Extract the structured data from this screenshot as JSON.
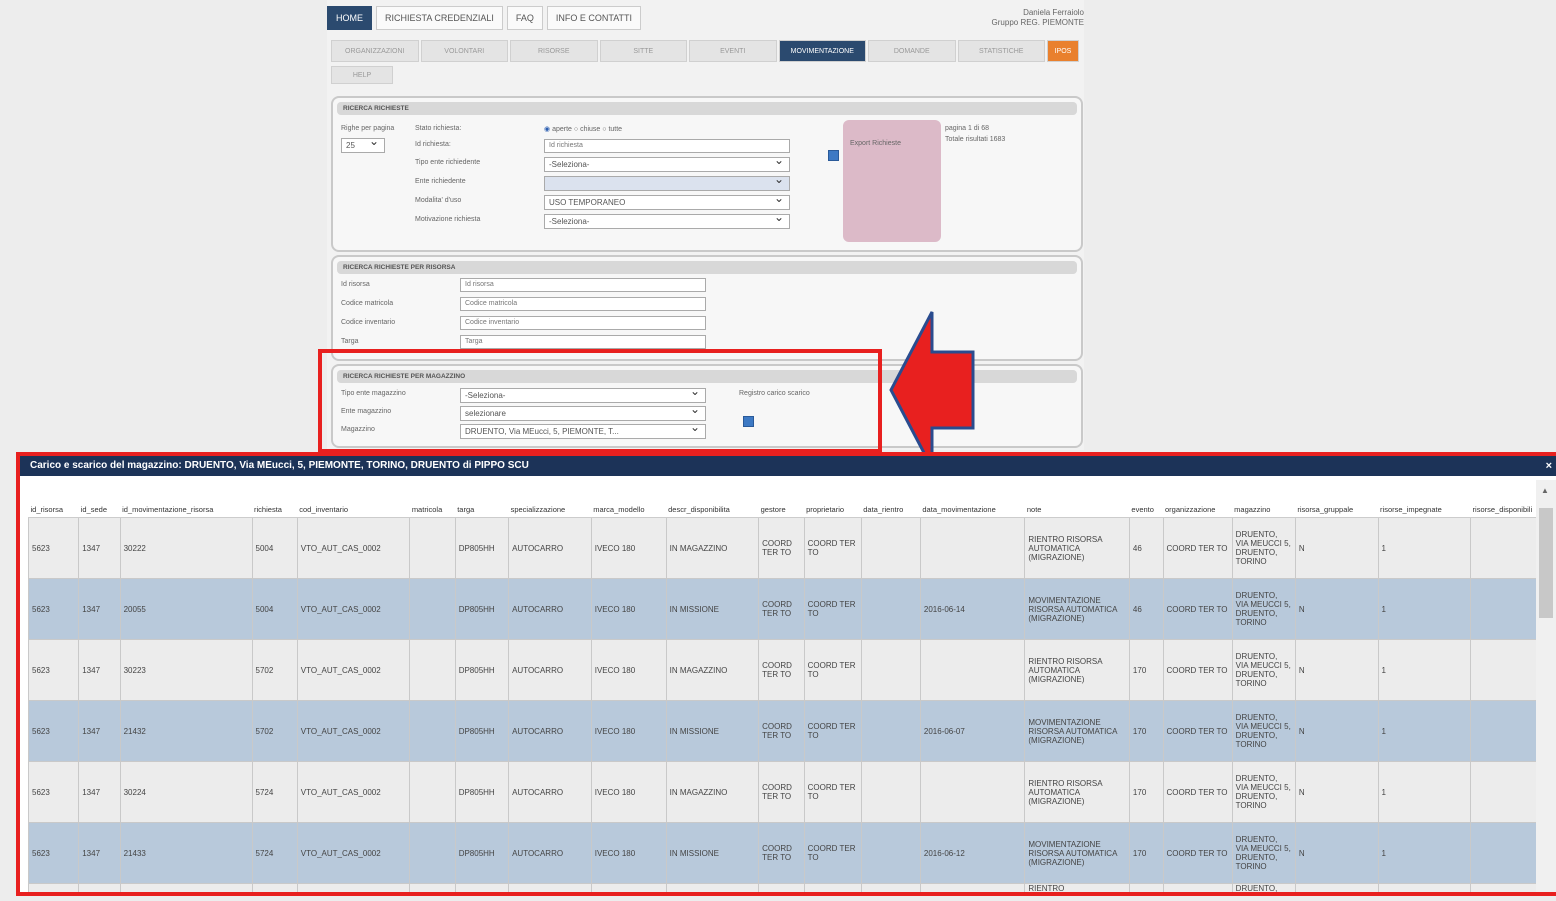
{
  "topnav": [
    "HOME",
    "RICHIESTA CREDENZIALI",
    "FAQ",
    "INFO E CONTATTI"
  ],
  "user": {
    "name": "Daniela Ferraiolo",
    "group": "Gruppo REG. PIEMONTE"
  },
  "subnav": [
    "ORGANIZZAZIONI",
    "VOLONTARI",
    "RISORSE",
    "SITTE",
    "EVENTI",
    "MOVIMENTAZIONE",
    "DOMANDE",
    "STATISTICHE",
    "IPOS"
  ],
  "help_label": "HELP",
  "ricerca": {
    "title": "RICERCA RICHIESTE",
    "righe_label": "Righe per pagina",
    "righe_value": "25",
    "stato_label": "Stato richiesta:",
    "stato_options": [
      "aperte",
      "chiuse",
      "tutte"
    ],
    "id_label": "Id richiesta:",
    "id_placeholder": "Id richiesta",
    "tipo_label": "Tipo ente richiedente",
    "tipo_value": "-Seleziona-",
    "ente_label": "Ente richiedente",
    "modalita_label": "Modalita' d'uso",
    "modalita_value": "USO TEMPORANEO",
    "motivazione_label": "Motivazione richiesta",
    "motivazione_value": "-Seleziona-",
    "export_label": "Export Richieste",
    "pagina": "pagina 1 di 68",
    "totale": "Totale risultati 1683"
  },
  "risorsa": {
    "title": "RICERCA RICHIESTE PER RISORSA",
    "fields": [
      {
        "label": "Id risorsa",
        "placeholder": "Id risorsa"
      },
      {
        "label": "Codice matricola",
        "placeholder": "Codice matricola"
      },
      {
        "label": "Codice inventario",
        "placeholder": "Codice inventario"
      },
      {
        "label": "Targa",
        "placeholder": "Targa"
      }
    ]
  },
  "magazzino": {
    "title": "RICERCA RICHIESTE PER MAGAZZINO",
    "tipo_label": "Tipo ente magazzino",
    "tipo_value": "-Seleziona-",
    "ente_label": "Ente magazzino",
    "ente_value": "selezionare",
    "mag_label": "Magazzino",
    "mag_value": "DRUENTO, Via MEucci, 5, PIEMONTE, T...",
    "registro_label": "Registro carico scarico"
  },
  "popup": {
    "title": "Carico e scarico del magazzino: DRUENTO, Via MEucci, 5, PIEMONTE, TORINO, DRUENTO di PIPPO SCU",
    "close": "×",
    "columns": [
      "id_risorsa",
      "id_sede",
      "id_movimentazione_risorsa",
      "richiesta",
      "cod_inventario",
      "matricola",
      "targa",
      "specializzazione",
      "marca_modello",
      "descr_disponibilita",
      "gestore",
      "proprietario",
      "data_rientro",
      "data_movimentazione",
      "note",
      "evento",
      "organizzazione",
      "magazzino",
      "risorsa_gruppale",
      "risorse_impegnate",
      "risorse_disponibili"
    ],
    "rows": [
      [
        "5623",
        "1347",
        "30222",
        "5004",
        "VTO_AUT_CAS_0002",
        "",
        "DP805HH",
        "AUTOCARRO",
        "IVECO 180",
        "IN MAGAZZINO",
        "COORD TER TO",
        "COORD TER TO",
        "",
        "",
        "RIENTRO RISORSA AUTOMATICA (MIGRAZIONE)",
        "46",
        "COORD TER TO",
        "DRUENTO, VIA MEUCCI 5, DRUENTO, TORINO",
        "N",
        "1",
        ""
      ],
      [
        "5623",
        "1347",
        "20055",
        "5004",
        "VTO_AUT_CAS_0002",
        "",
        "DP805HH",
        "AUTOCARRO",
        "IVECO 180",
        "IN MISSIONE",
        "COORD TER TO",
        "COORD TER TO",
        "",
        "2016-06-14",
        "MOVIMENTAZIONE RISORSA AUTOMATICA (MIGRAZIONE)",
        "46",
        "COORD TER TO",
        "DRUENTO, VIA MEUCCI 5, DRUENTO, TORINO",
        "N",
        "1",
        ""
      ],
      [
        "5623",
        "1347",
        "30223",
        "5702",
        "VTO_AUT_CAS_0002",
        "",
        "DP805HH",
        "AUTOCARRO",
        "IVECO 180",
        "IN MAGAZZINO",
        "COORD TER TO",
        "COORD TER TO",
        "",
        "",
        "RIENTRO RISORSA AUTOMATICA (MIGRAZIONE)",
        "170",
        "COORD TER TO",
        "DRUENTO, VIA MEUCCI 5, DRUENTO, TORINO",
        "N",
        "1",
        ""
      ],
      [
        "5623",
        "1347",
        "21432",
        "5702",
        "VTO_AUT_CAS_0002",
        "",
        "DP805HH",
        "AUTOCARRO",
        "IVECO 180",
        "IN MISSIONE",
        "COORD TER TO",
        "COORD TER TO",
        "",
        "2016-06-07",
        "MOVIMENTAZIONE RISORSA AUTOMATICA (MIGRAZIONE)",
        "170",
        "COORD TER TO",
        "DRUENTO, VIA MEUCCI 5, DRUENTO, TORINO",
        "N",
        "1",
        ""
      ],
      [
        "5623",
        "1347",
        "30224",
        "5724",
        "VTO_AUT_CAS_0002",
        "",
        "DP805HH",
        "AUTOCARRO",
        "IVECO 180",
        "IN MAGAZZINO",
        "COORD TER TO",
        "COORD TER TO",
        "",
        "",
        "RIENTRO RISORSA AUTOMATICA (MIGRAZIONE)",
        "170",
        "COORD TER TO",
        "DRUENTO, VIA MEUCCI 5, DRUENTO, TORINO",
        "N",
        "1",
        ""
      ],
      [
        "5623",
        "1347",
        "21433",
        "5724",
        "VTO_AUT_CAS_0002",
        "",
        "DP805HH",
        "AUTOCARRO",
        "IVECO 180",
        "IN MISSIONE",
        "COORD TER TO",
        "COORD TER TO",
        "",
        "2016-06-12",
        "MOVIMENTAZIONE RISORSA AUTOMATICA (MIGRAZIONE)",
        "170",
        "COORD TER TO",
        "DRUENTO, VIA MEUCCI 5, DRUENTO, TORINO",
        "N",
        "1",
        ""
      ]
    ],
    "partial_row": [
      "",
      "",
      "",
      "",
      "",
      "",
      "",
      "",
      "",
      "",
      "",
      "",
      "",
      "",
      "RIENTRO",
      "",
      "",
      "DRUENTO,",
      "",
      "",
      ""
    ]
  },
  "colors": {
    "red": "#e8201f",
    "navy": "#1c3358",
    "row_alt": "#b8c9db",
    "orange": "#e9802d"
  }
}
